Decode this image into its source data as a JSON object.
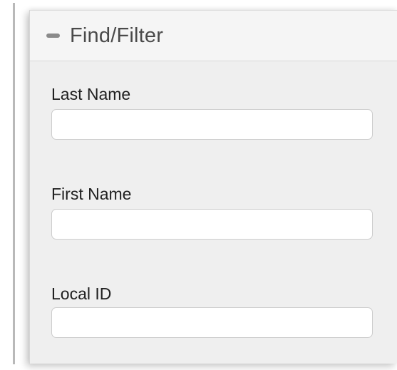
{
  "panel": {
    "title": "Find/Filter",
    "collapse_icon": "minus-icon"
  },
  "fields": [
    {
      "label": "Last Name",
      "value": "",
      "placeholder": ""
    },
    {
      "label": "First Name",
      "value": "",
      "placeholder": ""
    },
    {
      "label": "Local ID",
      "value": "",
      "placeholder": ""
    }
  ],
  "colors": {
    "panel_bg": "#efefef",
    "header_bg": "#f5f5f5",
    "input_border": "#cccccc"
  }
}
